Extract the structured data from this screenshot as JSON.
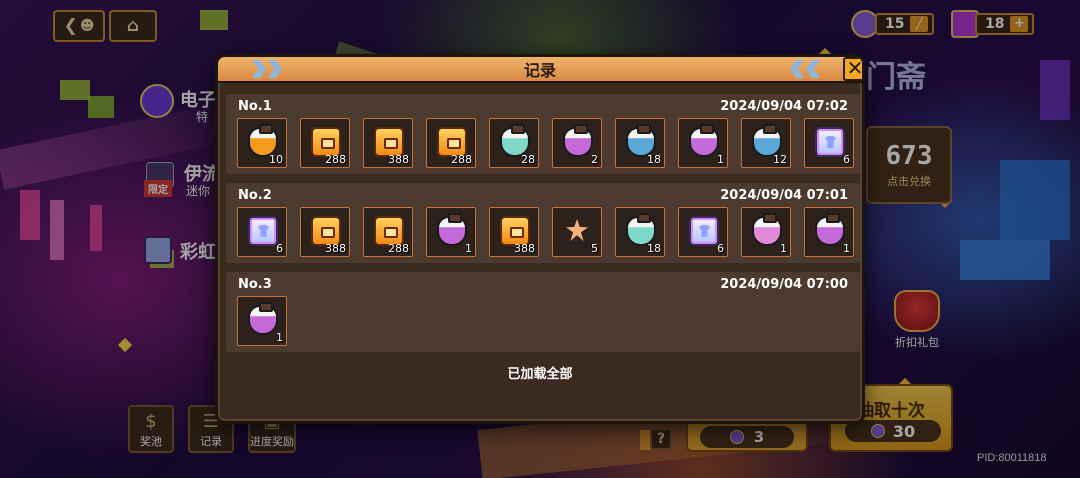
{
  "nav": {
    "back_icon": "back-arrow-icon",
    "home_icon": "home-icon"
  },
  "currency": {
    "tokens": {
      "value": "15",
      "icon": "token-icon",
      "color": "#8a5ad8"
    },
    "gems": {
      "value": "18",
      "icon": "gem-icon",
      "color": "#b23ad8"
    }
  },
  "background": {
    "banner_fragment": "门斋",
    "items": [
      {
        "label": "电子",
        "sub": "特"
      },
      {
        "label": "伊流",
        "sub": "迷你",
        "badge": "限定"
      },
      {
        "label": "彩虹"
      }
    ],
    "exchange": {
      "value": "673",
      "label": "点击兑换"
    },
    "gift": {
      "label": "折扣礼包"
    },
    "draw_ten": {
      "label": "抽取十次",
      "cost": "30"
    },
    "draw_one": {
      "cost": "3"
    },
    "bottom_buttons": [
      {
        "label": "奖池",
        "icon": "money-bag-icon"
      },
      {
        "label": "记录",
        "icon": "list-icon"
      },
      {
        "label": "进度奖励",
        "icon": "gift-icon"
      }
    ],
    "help": "?",
    "pid": "PID:80011818"
  },
  "modal": {
    "title": "记录",
    "close": "✕",
    "footer": "已加载全部",
    "records": [
      {
        "no": "No.1",
        "time": "2024/09/04 07:02",
        "items": [
          {
            "type": "potion",
            "color": "#f59a1a",
            "qty": "10"
          },
          {
            "type": "coin",
            "color": "#f5a020",
            "qty": "288"
          },
          {
            "type": "coin",
            "color": "#f5a020",
            "qty": "388"
          },
          {
            "type": "coin",
            "color": "#f5a020",
            "qty": "288"
          },
          {
            "type": "potion",
            "color": "#7fd8c8",
            "qty": "28"
          },
          {
            "type": "potion",
            "color": "#c46ad8",
            "qty": "2"
          },
          {
            "type": "potion",
            "color": "#5aa8d8",
            "qty": "18"
          },
          {
            "type": "potion",
            "color": "#c46ad8",
            "qty": "1"
          },
          {
            "type": "potion",
            "color": "#5aa8d8",
            "qty": "12"
          },
          {
            "type": "shirt",
            "color": "#b4c2ff",
            "qty": "6"
          }
        ]
      },
      {
        "no": "No.2",
        "time": "2024/09/04 07:01",
        "items": [
          {
            "type": "shirt",
            "color": "#b4c2ff",
            "qty": "6"
          },
          {
            "type": "coin",
            "color": "#f5a020",
            "qty": "388"
          },
          {
            "type": "coin",
            "color": "#f5a020",
            "qty": "288"
          },
          {
            "type": "potion",
            "color": "#c46ad8",
            "qty": "1"
          },
          {
            "type": "coin",
            "color": "#f5a020",
            "qty": "388"
          },
          {
            "type": "star",
            "color": "#f4b27a",
            "qty": "5"
          },
          {
            "type": "potion",
            "color": "#7fd8c8",
            "qty": "18"
          },
          {
            "type": "shirt",
            "color": "#b4c2ff",
            "qty": "6"
          },
          {
            "type": "potion",
            "color": "#e08ad8",
            "qty": "1"
          },
          {
            "type": "potion",
            "color": "#c46ad8",
            "qty": "1"
          }
        ]
      },
      {
        "no": "No.3",
        "time": "2024/09/04 07:00",
        "items": [
          {
            "type": "potion",
            "color": "#c46ad8",
            "qty": "1"
          }
        ]
      }
    ]
  }
}
